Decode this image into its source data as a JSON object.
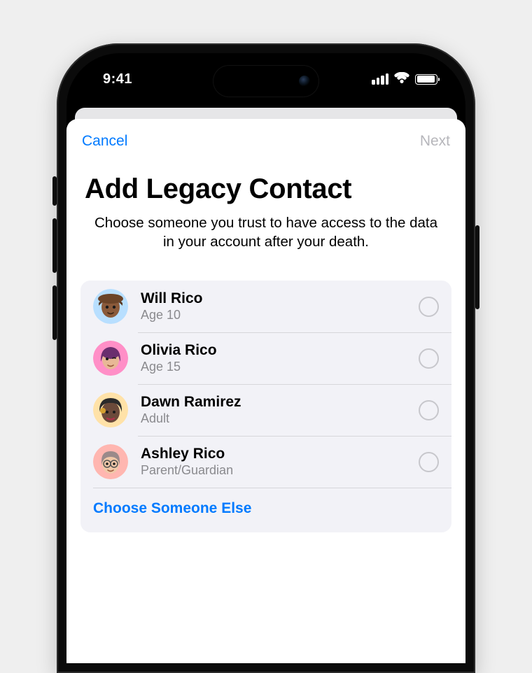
{
  "status": {
    "time": "9:41"
  },
  "header": {
    "cancel": "Cancel",
    "next": "Next"
  },
  "page": {
    "title": "Add Legacy Contact",
    "subtitle": "Choose someone you trust to have access to the data in your account after your death."
  },
  "contacts": [
    {
      "name": "Will Rico",
      "sub": "Age 10",
      "avatar_bg": "#b8dfff"
    },
    {
      "name": "Olivia Rico",
      "sub": "Age 15",
      "avatar_bg": "#ff8fc7"
    },
    {
      "name": "Dawn Ramirez",
      "sub": "Adult",
      "avatar_bg": "#ffe2a8"
    },
    {
      "name": "Ashley Rico",
      "sub": "Parent/Guardian",
      "avatar_bg": "#ffb6b0"
    }
  ],
  "choose_else": "Choose Someone Else",
  "colors": {
    "accent": "#007aff",
    "disabled": "#b6b6bb",
    "card_bg": "#f2f2f7",
    "secondary_text": "#8a8a8e"
  }
}
